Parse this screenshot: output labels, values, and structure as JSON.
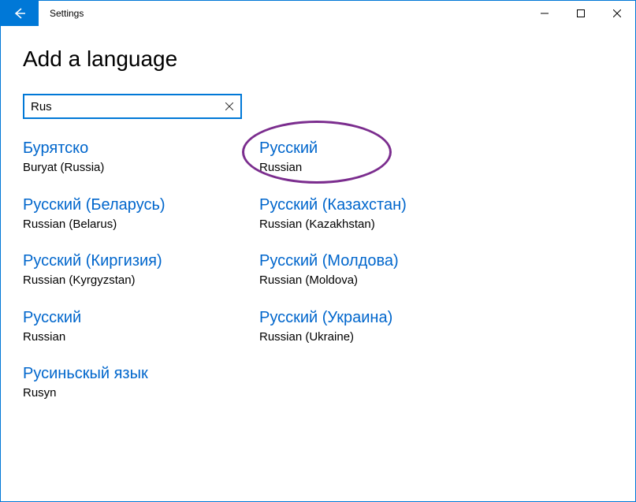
{
  "window": {
    "title": "Settings"
  },
  "page": {
    "heading": "Add a language"
  },
  "search": {
    "value": "Rus"
  },
  "languages": [
    {
      "native": "Бурятско",
      "local": "Buryat (Russia)"
    },
    {
      "native": "Русский",
      "local": "Russian"
    },
    {
      "native": "Русский (Беларусь)",
      "local": "Russian (Belarus)"
    },
    {
      "native": "Русский (Казахстан)",
      "local": "Russian (Kazakhstan)"
    },
    {
      "native": "Русский (Киргизия)",
      "local": "Russian (Kyrgyzstan)"
    },
    {
      "native": "Русский (Молдова)",
      "local": "Russian (Moldova)"
    },
    {
      "native": "Русский",
      "local": "Russian"
    },
    {
      "native": "Русский (Украина)",
      "local": "Russian (Ukraine)"
    },
    {
      "native": "Русиньскый язык",
      "local": "Rusyn"
    }
  ],
  "annotation": {
    "highlighted_index": 1,
    "color": "#7b2d8e"
  }
}
